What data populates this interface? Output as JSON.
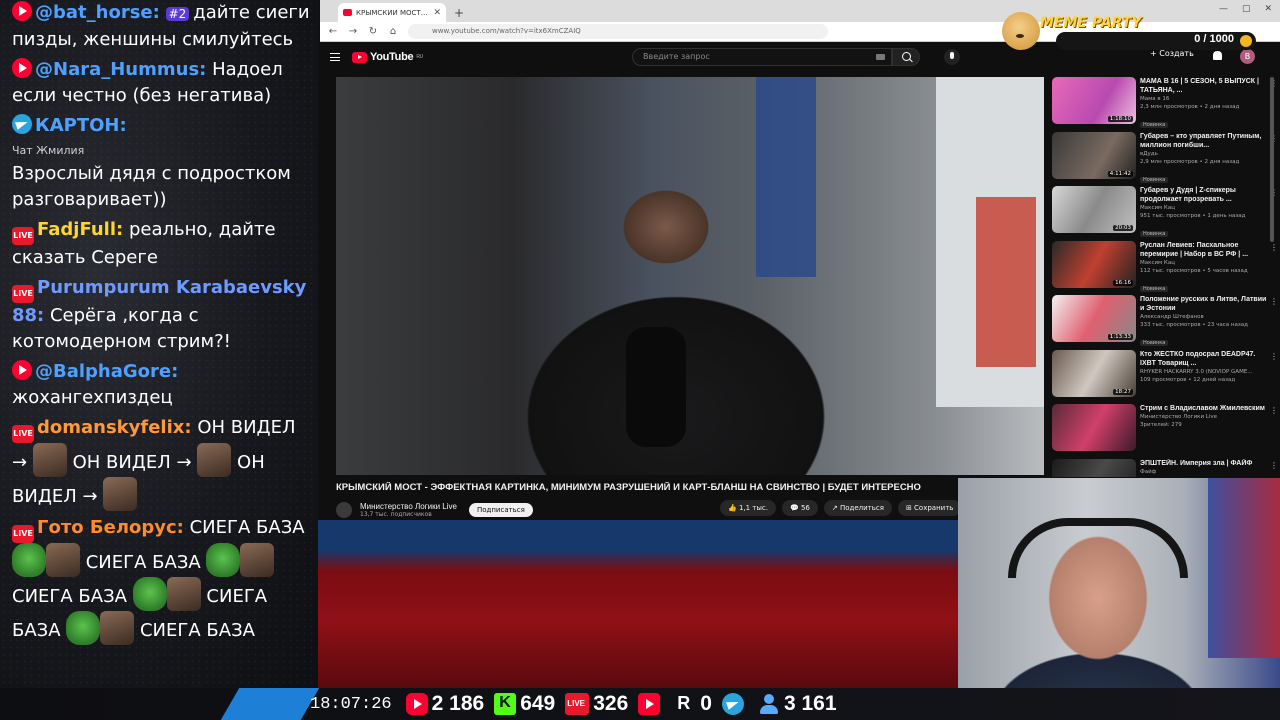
{
  "chat": {
    "messages": [
      {
        "type": "yt",
        "user": "@bat_horse:",
        "tag": "#2",
        "text": "дайте сиеги пизды, женшины смилуйтесь"
      },
      {
        "type": "yt",
        "user": "@Nara_Hummus:",
        "text": "Надоел если честно (без негатива)"
      },
      {
        "type": "tg",
        "user": "КАРТОН:",
        "text": ""
      },
      {
        "type": "label",
        "text": "Чат Жмилия"
      },
      {
        "type": "plain",
        "user": "",
        "text": "Взрослый дядя с подростком разговаривает))"
      },
      {
        "type": "vk",
        "user": "FadjFull:",
        "text": "реально, дайте сказать Сереге"
      },
      {
        "type": "vk",
        "user": "Purumpurum Karabaevsky 88:",
        "text": "Серёга ,когда с котомодерном стрим?!"
      },
      {
        "type": "yt",
        "user": "@BalphaGore:",
        "text": "жохангехпиздец"
      },
      {
        "type": "vk",
        "user": "domanskyfelix:",
        "text": "ОН ВИДЕЛ →",
        "emote_text": [
          "ОН ВИДЕЛ →",
          "ОН ВИДЕЛ →"
        ]
      },
      {
        "type": "vk",
        "user": "Гото Белорус:",
        "text": "СИЕГА БАЗА",
        "repeat": "СИЕГА БАЗА"
      }
    ],
    "colors": {
      "yt_user": "#4fa0ff",
      "tg_user": "#4fa0ff",
      "vk_user": "#ffd52e",
      "vk_user_alt": "#6f9aff",
      "vk_user_orange": "#ff9a3c",
      "gold_user": "#ff8b2e"
    }
  },
  "stats": {
    "clock": "18:07:26",
    "youtube": "2 186",
    "kick": "649",
    "vk_live": "326",
    "rutube": "",
    "r_count": "0",
    "total": "3 161"
  },
  "browser": {
    "tab_title": "КРЫМСКИЙ МОСТ - ЭФФЕКТН...",
    "url": "www.youtube.com/watch?v=itx6XmCZAIQ",
    "win_controls": [
      "—",
      "▢",
      "✕"
    ]
  },
  "youtube": {
    "logo": "YouTube",
    "logo_region": "RU",
    "search_placeholder": "Введите запрос",
    "create_label": "+ Создать",
    "avatar_letter": "В",
    "video_title": "КРЫМСКИЙ МОСТ - ЭФФЕКТНАЯ КАРТИНКА, МИНИМУМ РАЗРУШЕНИЙ И КАРТ-БЛАНШ НА СВИНСТВО | БУДЕТ ИНТЕРЕСНО",
    "channel_name": "Министерство Логики Live",
    "channel_subs": "13,7 тыс. подписчиков",
    "subscribe": "Подписаться",
    "likes": "1,1 тыс.",
    "comments": "56",
    "share": "Поделиться",
    "save": "Сохранить"
  },
  "recommendations": [
    {
      "title": "МАМА В 16 | 5 СЕЗОН, 5 ВЫПУСК | ТАТЬЯНА, ...",
      "channel": "Мама в 16",
      "meta": "2,3 млн просмотров • 2 дня назад",
      "badge": "Новинка",
      "duration": "1:18:10",
      "thumb": "linear-gradient(120deg,#e86ab8,#b84ab0 60%,#f0c0e0)"
    },
    {
      "title": "Губарев – кто управляет Путиным, миллион погибши...",
      "channel": "вДудь",
      "meta": "2,9 млн просмотров • 2 дня назад",
      "badge": "Новинка",
      "duration": "4:11:42",
      "thumb": "linear-gradient(120deg,#3a3a3a,#7a6a60 60%,#222)"
    },
    {
      "title": "Губарев у Дудя | Z-спикеры продолжает прозревать ...",
      "channel": "Максим Кац",
      "meta": "951 тыс. просмотров • 1 день назад",
      "badge": "Новинка",
      "duration": "20:03",
      "thumb": "linear-gradient(120deg,#d8d8d8,#8a8a8a 50%,#c0c0c0)"
    },
    {
      "title": "Руслан Левиев: Пасхальное перемирие | Набор в ВС РФ | ...",
      "channel": "Максим Кац",
      "meta": "112 тыс. просмотров • 5 часов назад",
      "badge": "Новинка",
      "duration": "16:16",
      "thumb": "linear-gradient(120deg,#2a2a2a,#c04030 50%,#222)"
    },
    {
      "title": "Положение русских в Литве, Латвии и Эстонии",
      "channel": "Александр Штефанов",
      "meta": "333 тыс. просмотров • 23 часа назад",
      "badge": "Новинка",
      "duration": "1:13:33",
      "thumb": "linear-gradient(120deg,#f2f2f2,#e06070 50%,#888)"
    },
    {
      "title": "Кто ЖЕСТКО подосрал DEADP47. IXBT Товарищ ...",
      "channel": "RHYKER HACKARRY 3.0 (NOVIOP GAME...",
      "meta": "109 просмотров • 12 дней назад",
      "badge": "",
      "duration": "18:27",
      "thumb": "linear-gradient(120deg,#6a5a50,#d0c8c0 50%,#4a4038)"
    },
    {
      "title": "Стрим с Владиславом Жмилевским",
      "channel": "Министерство Логики Live",
      "meta": "Зрителей: 279",
      "badge": "",
      "duration": "",
      "thumb": "linear-gradient(120deg,#5a2a3a,#d0406a 50%,#3a1a2a)"
    },
    {
      "title": "ЭПШТЕЙН. Империя зла | ФАЙФ",
      "channel": "Файф",
      "meta": "",
      "badge": "",
      "duration": "",
      "thumb": "linear-gradient(120deg,#1a1a1a,#4a4a4a 50%,#1a1a1a)"
    }
  ],
  "meme_party": {
    "title": "MEME PARTY",
    "count": "0 / 1000"
  }
}
